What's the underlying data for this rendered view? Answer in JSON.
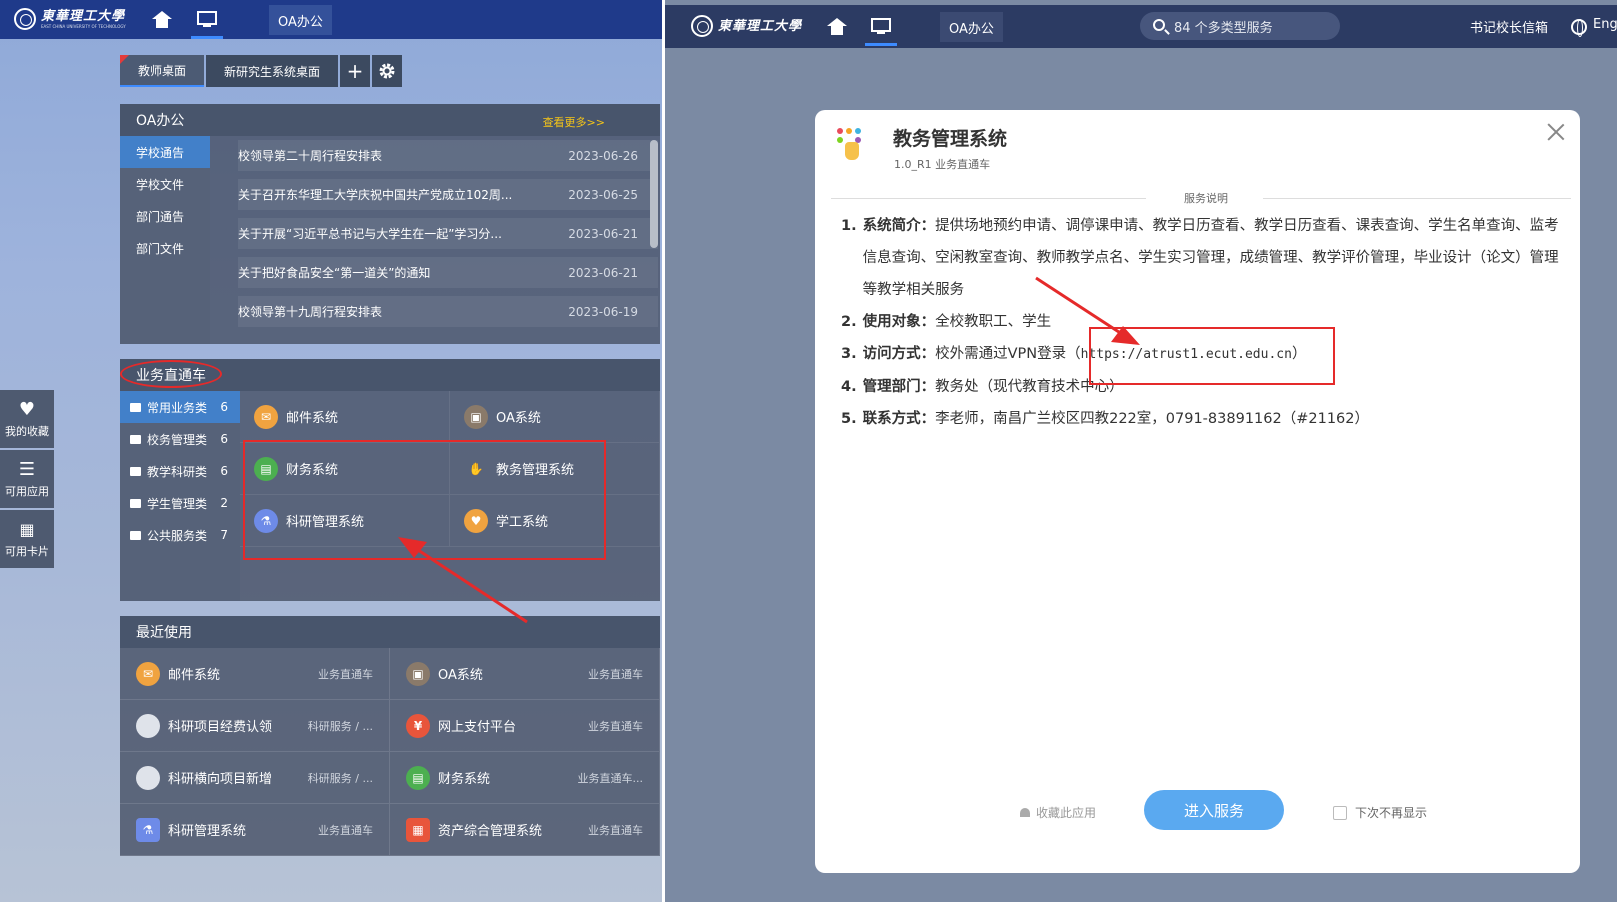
{
  "left": {
    "topbar": {
      "logo_text": "東華理工大學",
      "logo_sub": "EAST CHINA UNIVERSITY OF TECHNOLOGY",
      "oa_tab": "OA办公"
    },
    "desk_tabs": [
      "教师桌面",
      "新研究生系统桌面"
    ],
    "add_symbol": "+",
    "oa_panel": {
      "title": "OA办公",
      "more": "查看更多>>",
      "categories": [
        "学校通告",
        "学校文件",
        "部门通告",
        "部门文件"
      ],
      "news": [
        {
          "title": "校领导第二十周行程安排表",
          "date": "2023-06-26"
        },
        {
          "title": "关于召开东华理工大学庆祝中国共产党成立102周...",
          "date": "2023-06-25"
        },
        {
          "title": "关于开展“习近平总书记与大学生在一起”学习分...",
          "date": "2023-06-21"
        },
        {
          "title": "关于把好食品安全“第一道关”的通知",
          "date": "2023-06-21"
        },
        {
          "title": "校领导第十九周行程安排表",
          "date": "2023-06-19"
        }
      ]
    },
    "svc_panel": {
      "title": "业务直通车",
      "categories": [
        {
          "label": "常用业务类",
          "count": "6"
        },
        {
          "label": "校务管理类",
          "count": "6"
        },
        {
          "label": "教学科研类",
          "count": "6"
        },
        {
          "label": "学生管理类",
          "count": "2"
        },
        {
          "label": "公共服务类",
          "count": "7"
        }
      ],
      "tiles": [
        "邮件系统",
        "OA系统",
        "财务系统",
        "教务管理系统",
        "科研管理系统",
        "学工系统"
      ]
    },
    "recent_panel": {
      "title": "最近使用",
      "items": [
        {
          "name": "邮件系统",
          "cat": "业务直通车"
        },
        {
          "name": "OA系统",
          "cat": "业务直通车"
        },
        {
          "name": "科研项目经费认领",
          "cat": "科研服务 / ..."
        },
        {
          "name": "网上支付平台",
          "cat": "业务直通车"
        },
        {
          "name": "科研横向项目新增",
          "cat": "科研服务 / ..."
        },
        {
          "name": "财务系统",
          "cat": "业务直通车..."
        },
        {
          "name": "科研管理系统",
          "cat": "业务直通车"
        },
        {
          "name": "资产综合管理系统",
          "cat": "业务直通车"
        }
      ]
    },
    "dock": [
      "我的收藏",
      "可用应用",
      "可用卡片"
    ]
  },
  "right": {
    "topbar": {
      "logo_text": "東華理工大學",
      "oa_tab": "OA办公",
      "search": "84 个多类型服务",
      "mailbox": "书记校长信箱",
      "lang": "Eng"
    },
    "modal": {
      "title": "教务管理系统",
      "subtitle": "1.0_R1 业务直通车",
      "divider": "服务说明",
      "items": [
        {
          "num": "1.",
          "key": "系统简介：",
          "text": "提供场地预约申请、调停课申请、教学日历查看、教学日历查看、课表查询、学生名单查询、监考信息查询、空闲教室查询、教师教学点名、学生实习管理，成绩管理、教学评价管理，毕业设计（论文）管理等教学相关服务"
        },
        {
          "num": "2.",
          "key": "使用对象：",
          "text": "全校教职工、学生"
        },
        {
          "num": "3.",
          "key": "访问方式：",
          "text": "校外需通过VPN登录（",
          "link": "https://atrust1.ecut.edu.cn",
          "tail": "）"
        },
        {
          "num": "4.",
          "key": "管理部门：",
          "text": "教务处（现代教育技术中心）"
        },
        {
          "num": "5.",
          "key": "联系方式：",
          "text": "李老师，南昌广兰校区四教222室，0791-83891162（#21162）"
        }
      ],
      "fav": "收藏此应用",
      "enter": "进入服务",
      "no_show": "下次不再显示"
    }
  },
  "colors": {
    "accent": "#3d8bff",
    "annotation_red": "#e52a2a",
    "enter_button": "#5aa9f0"
  }
}
